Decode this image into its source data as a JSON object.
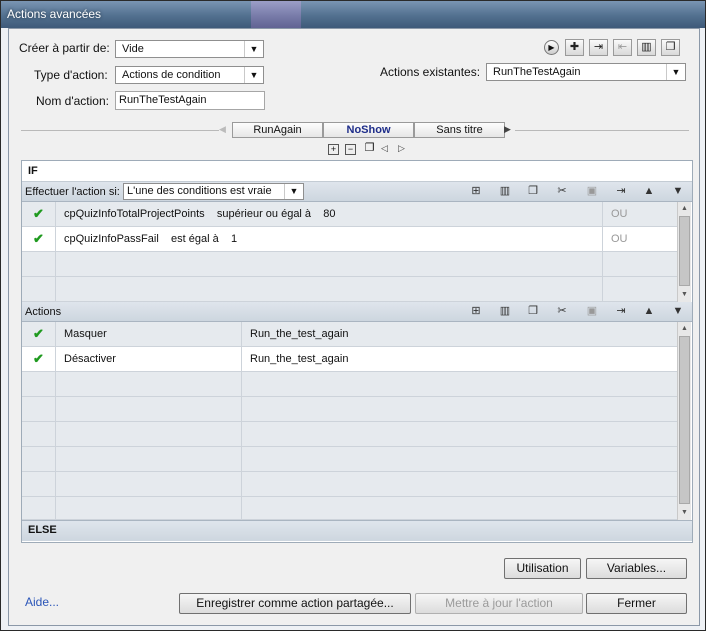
{
  "window": {
    "title": "Actions avancées"
  },
  "form": {
    "create_from_label": "Créer à partir de:",
    "create_from_value": "Vide",
    "action_type_label": "Type d'action:",
    "action_type_value": "Actions de condition",
    "action_name_label": "Nom d'action:",
    "action_name_value": "RunTheTestAgain",
    "existing_label": "Actions existantes:",
    "existing_value": "RunTheTestAgain"
  },
  "tabs": [
    "RunAgain",
    "NoShow",
    "Sans titre"
  ],
  "active_tab": "NoShow",
  "if_section": {
    "header": "IF",
    "perform_label": "Effectuer l'action si:",
    "perform_value": "L'une des conditions est vraie",
    "conditions": [
      {
        "variable": "cpQuizInfoTotalProjectPoints",
        "operator": "supérieur ou égal à",
        "value": "80",
        "connector": "OU"
      },
      {
        "variable": "cpQuizInfoPassFail",
        "operator": "est égal à",
        "value": "1",
        "connector": "OU"
      }
    ]
  },
  "actions_section": {
    "header": "Actions",
    "rows": [
      {
        "action": "Masquer",
        "target": "Run_the_test_again"
      },
      {
        "action": "Désactiver",
        "target": "Run_the_test_again"
      }
    ]
  },
  "else_section": {
    "header": "ELSE"
  },
  "buttons": {
    "usage": "Utilisation",
    "variables": "Variables...",
    "help": "Aide...",
    "save_shared": "Enregistrer comme action partagée...",
    "update": "Mettre à jour l'action",
    "close": "Fermer"
  },
  "icons": {
    "check": "✔",
    "play": "▶",
    "dropdown": "▼"
  },
  "colors": {
    "check": "#1f9a1f",
    "active_tab": "#1e2d8a",
    "link": "#2a55b8"
  }
}
